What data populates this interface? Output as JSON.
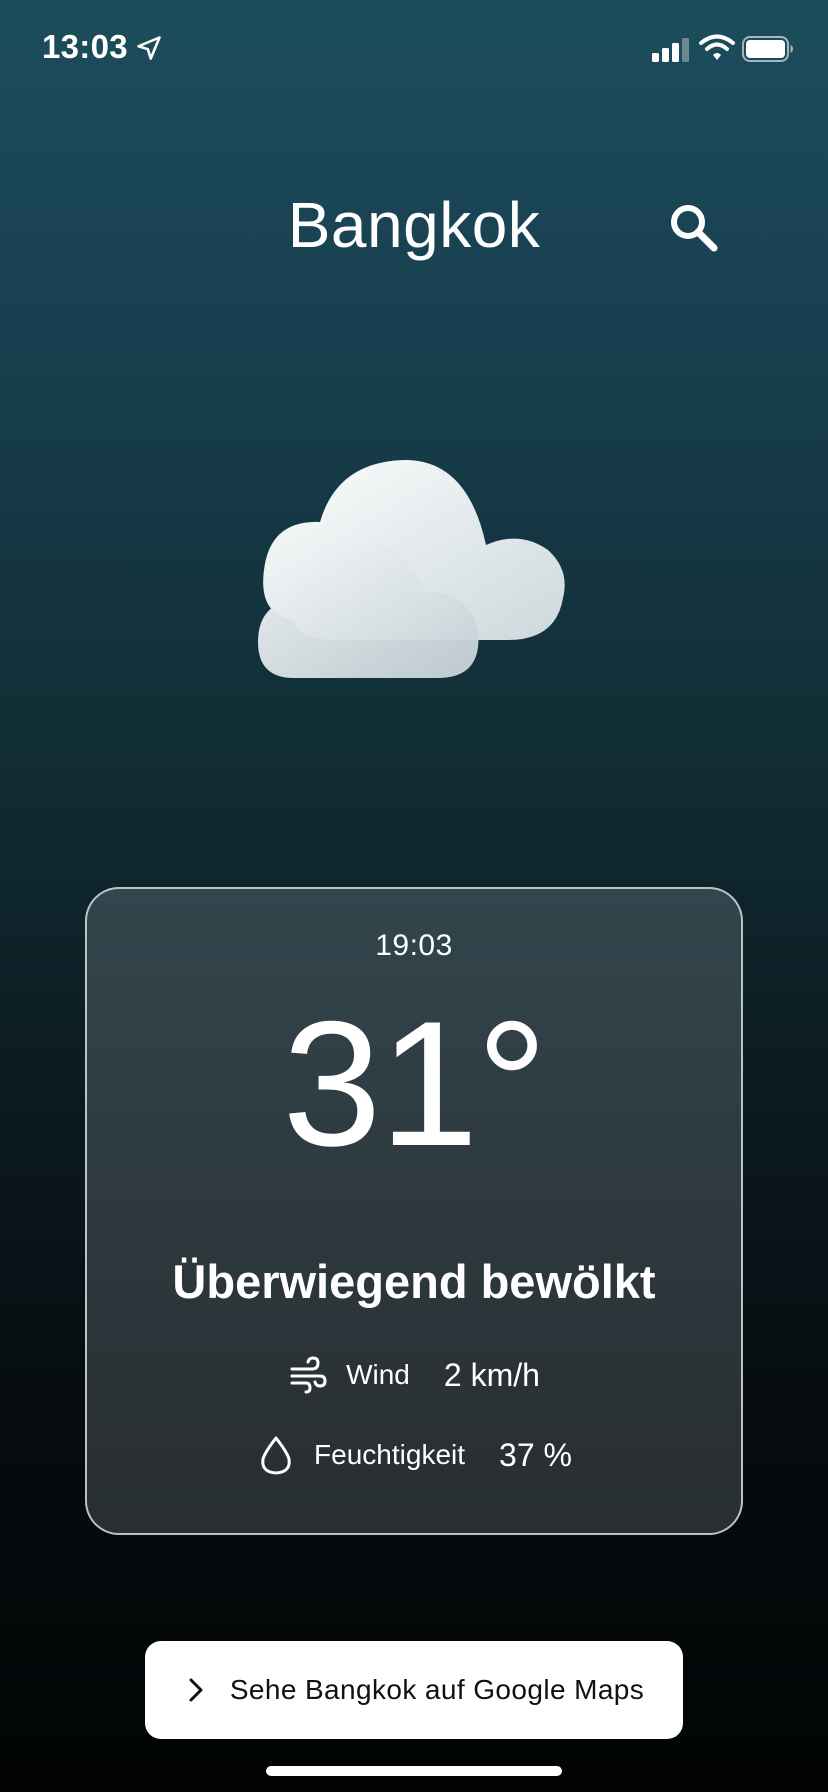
{
  "status_bar": {
    "time": "13:03",
    "location_icon": "location-arrow-icon",
    "signal_icon": "cellular-signal-icon",
    "wifi_icon": "wifi-icon",
    "battery_icon": "battery-icon"
  },
  "header": {
    "city": "Bangkok",
    "search_icon": "search-icon"
  },
  "illustration": {
    "icon": "cloud-icon"
  },
  "card": {
    "time": "19:03",
    "temperature": "31°",
    "condition": "Überwiegend bewölkt",
    "wind": {
      "icon": "wind-icon",
      "label": "Wind",
      "value": "2 km/h"
    },
    "humidity": {
      "icon": "droplet-icon",
      "label": "Feuchtigkeit",
      "value": "37 %"
    }
  },
  "maps_button": {
    "icon": "chevron-right-icon",
    "label": "Sehe Bangkok auf Google Maps"
  },
  "colors": {
    "background_top": "#1d4d5c",
    "background_bottom": "#020404",
    "text": "#ffffff",
    "button_background": "#ffffff",
    "button_text": "#111111"
  }
}
